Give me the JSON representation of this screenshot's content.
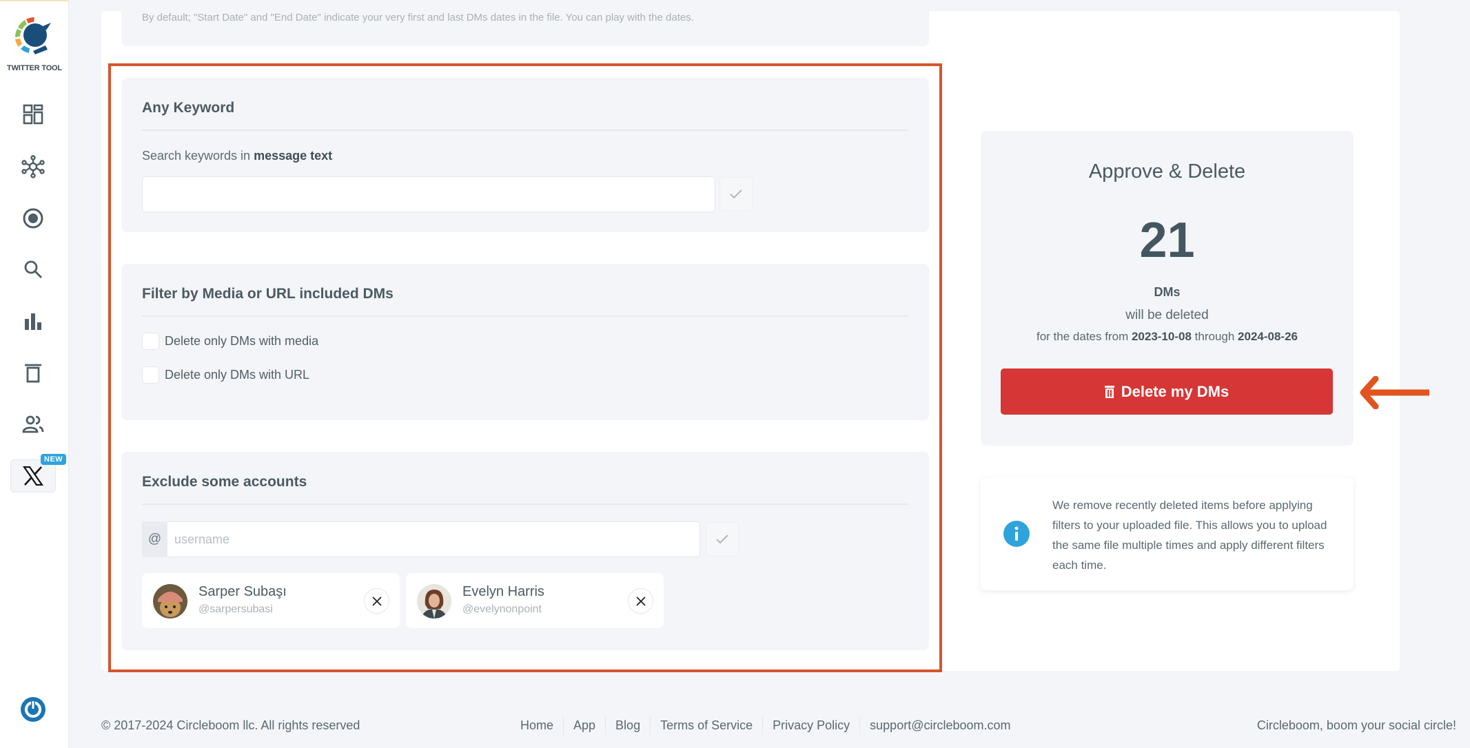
{
  "sidebar": {
    "logo_text": "TWITTER TOOL",
    "items": [
      {
        "name": "dashboard"
      },
      {
        "name": "network"
      },
      {
        "name": "circle"
      },
      {
        "name": "search"
      },
      {
        "name": "analytics"
      },
      {
        "name": "delete"
      },
      {
        "name": "users"
      }
    ],
    "x_badge": "NEW"
  },
  "date_section": {
    "note": "By default; \"Start Date\" and \"End Date\" indicate your very first and last DMs dates in the file. You can play with the dates."
  },
  "keyword_section": {
    "title": "Any Keyword",
    "label_prefix": "Search keywords in ",
    "label_bold": "message text",
    "input_value": "",
    "input_placeholder": ""
  },
  "media_section": {
    "title": "Filter by Media or URL included DMs",
    "options": [
      {
        "label": "Delete only DMs with media",
        "checked": false
      },
      {
        "label": "Delete only DMs with URL",
        "checked": false
      }
    ]
  },
  "exclude_section": {
    "title": "Exclude some accounts",
    "prefix": "@",
    "input_placeholder": "username",
    "accounts": [
      {
        "name": "Sarper Subaşı",
        "handle": "@sarpersubasi"
      },
      {
        "name": "Evelyn Harris",
        "handle": "@evelynonpoint"
      }
    ]
  },
  "approve": {
    "title": "Approve & Delete",
    "count": "21",
    "unit": "DMs",
    "will_text": "will be deleted",
    "dates_prefix": "for the dates from ",
    "date_from": "2023-10-08",
    "dates_middle": " through ",
    "date_to": "2024-08-26",
    "button_label": "Delete my DMs"
  },
  "info": {
    "text": "We remove recently deleted items before applying filters to your uploaded file. This allows you to upload the same file multiple times and apply different filters each time."
  },
  "footer": {
    "copyright": "© 2017-2024 Circleboom llc. All rights reserved",
    "links": [
      "Home",
      "App",
      "Blog",
      "Terms of Service",
      "Privacy Policy",
      "support@circleboom.com"
    ],
    "slogan": "Circleboom, boom your social circle!"
  },
  "colors": {
    "highlight": "#d4562e",
    "delete_button": "#d63635",
    "info_icon": "#2ea3dc",
    "brand_dark": "#1a4e7a"
  }
}
